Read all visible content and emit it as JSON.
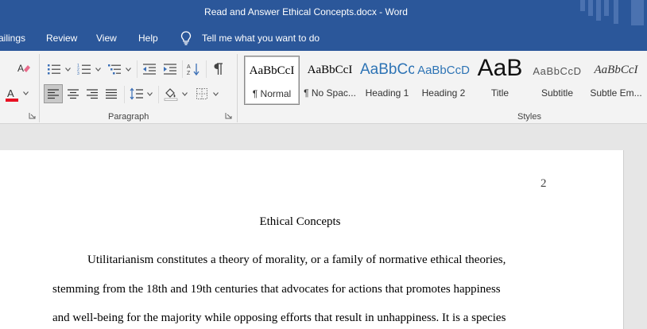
{
  "window": {
    "title": "Read and Answer Ethical Concepts.docx  -  Word"
  },
  "tabs": {
    "mailings": "ailings",
    "review": "Review",
    "view": "View",
    "help": "Help",
    "tell_me": "Tell me what you want to do"
  },
  "ribbon": {
    "paragraph_label": "Paragraph",
    "styles_label": "Styles",
    "styles": [
      {
        "preview": "AaBbCcI",
        "label": "¶ Normal"
      },
      {
        "preview": "AaBbCcI",
        "label": "¶ No Spac..."
      },
      {
        "preview": "AaBbCc",
        "label": "Heading 1"
      },
      {
        "preview": "AaBbCcD",
        "label": "Heading 2"
      },
      {
        "preview": "AaB",
        "label": "Title"
      },
      {
        "preview": "AaBbCcD",
        "label": "Subtitle"
      },
      {
        "preview": "AaBbCcI",
        "label": "Subtle Em..."
      }
    ],
    "colors": {
      "accent": "#2b579a",
      "font_color_bar": "#e81123",
      "heading_blue": "#2e74b5"
    }
  },
  "document": {
    "page_number": "2",
    "title": "Ethical Concepts",
    "lines": [
      "Utilitarianism constitutes a theory of morality, or a family of normative ethical theories,",
      "stemming from the 18th and 19th centuries that advocates for actions that promotes happiness",
      "and well-being for the majority while opposing efforts that result in unhappiness. It is a species"
    ]
  }
}
